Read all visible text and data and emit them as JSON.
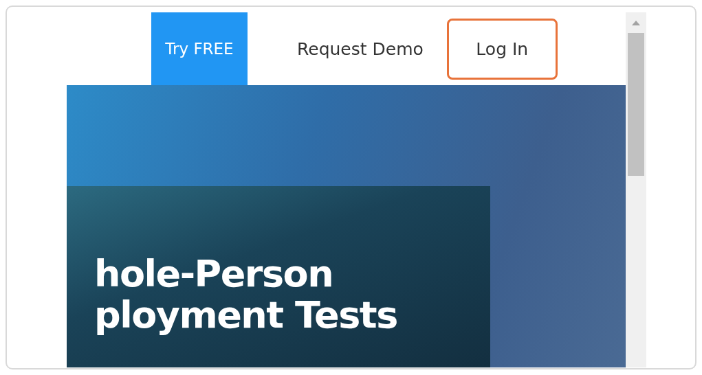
{
  "nav": {
    "buttons": [
      {
        "label": "Try FREE",
        "kind": "primary"
      },
      {
        "label": "Request Demo",
        "kind": "plain"
      },
      {
        "label": "Log In",
        "kind": "highlighted"
      }
    ]
  },
  "hero": {
    "headline": [
      "hole-Person",
      "ployment Tests"
    ]
  }
}
